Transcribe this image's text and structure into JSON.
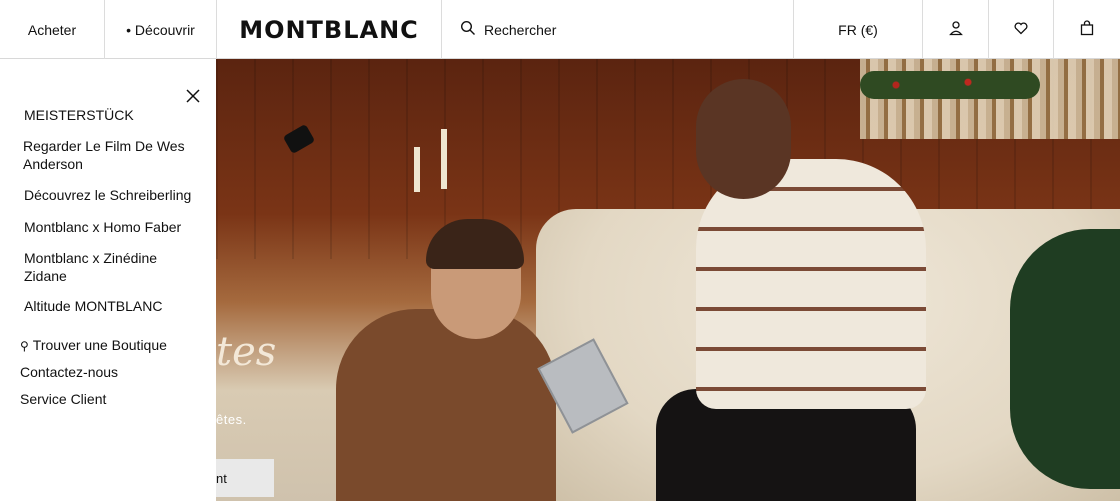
{
  "header": {
    "acheter": "Acheter",
    "decouvrir": "• Découvrir",
    "logo": "MONTBLANC",
    "search_placeholder": "Rechercher",
    "language": "FR (€)"
  },
  "panel": {
    "items": [
      "MEISTERSTÜCK",
      "Regarder Le Film De Wes Anderson",
      "Découvrez le Schreiberling",
      "Montblanc x Homo Faber",
      "Montblanc x Zinédine Zidane",
      "Altitude MONTBLANC"
    ],
    "boutique": "Trouver une Boutique",
    "contact": "Contactez-nous",
    "service": "Service Client"
  },
  "hero": {
    "script_text": "tes",
    "text": "êtes.",
    "cta": "nt"
  },
  "icons": {
    "search": "search-icon",
    "account": "user-icon",
    "wishlist": "heart-icon",
    "bag": "shopping-bag-icon",
    "close": "close-icon",
    "pin": "location-pin-icon"
  }
}
